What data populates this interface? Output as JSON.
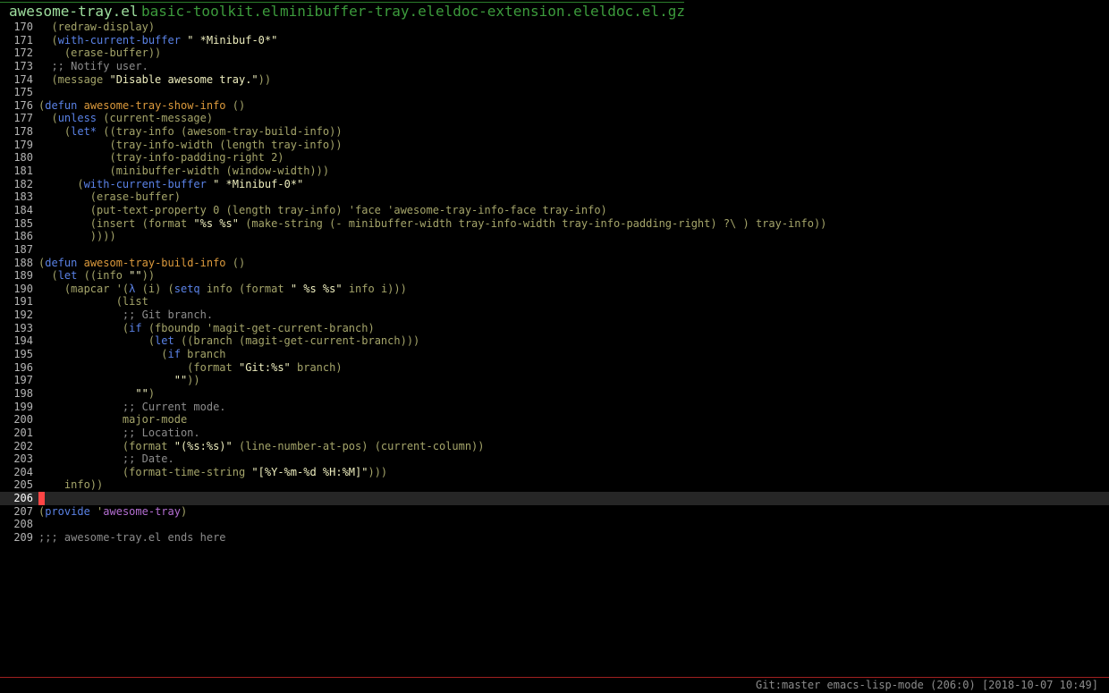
{
  "tabs": [
    {
      "label": "awesome-tray.el",
      "active": true
    },
    {
      "label": "basic-toolkit.el",
      "active": false
    },
    {
      "label": "minibuffer-tray.el",
      "active": false
    },
    {
      "label": "eldoc-extension.el",
      "active": false
    },
    {
      "label": "eldoc.el.gz",
      "active": false
    }
  ],
  "colors": {
    "background": "#000000",
    "tab_active": "#9fe09f",
    "tab_inactive": "#3c9b3c",
    "code_default": "#a5a56a",
    "keyword": "#5a82e6",
    "string": "#eeeebe",
    "comment": "#8c8c8c",
    "function_name": "#dc9a3c",
    "quoted_symbol": "#b46ed2",
    "cursor": "#ff4545",
    "current_line": "#262626"
  },
  "editor": {
    "current_line": 206,
    "lines": [
      {
        "n": 170,
        "tokens": [
          [
            "p",
            "  (redraw-display)"
          ]
        ]
      },
      {
        "n": 171,
        "tokens": [
          [
            "p",
            "  ("
          ],
          [
            "k",
            "with-current-buffer"
          ],
          [
            "p",
            " "
          ],
          [
            "s",
            "\" *Minibuf-0*\""
          ]
        ]
      },
      {
        "n": 172,
        "tokens": [
          [
            "p",
            "    (erase-buffer))"
          ]
        ]
      },
      {
        "n": 173,
        "tokens": [
          [
            "c",
            "  ;; Notify user."
          ]
        ]
      },
      {
        "n": 174,
        "tokens": [
          [
            "p",
            "  (message "
          ],
          [
            "s",
            "\"Disable awesome tray.\""
          ],
          [
            "p",
            "))"
          ]
        ]
      },
      {
        "n": 175,
        "tokens": []
      },
      {
        "n": 176,
        "tokens": [
          [
            "p",
            "("
          ],
          [
            "k",
            "defun"
          ],
          [
            "p",
            " "
          ],
          [
            "f",
            "awesome-tray-show-info"
          ],
          [
            "p",
            " ()"
          ]
        ]
      },
      {
        "n": 177,
        "tokens": [
          [
            "p",
            "  ("
          ],
          [
            "k",
            "unless"
          ],
          [
            "p",
            " (current-message)"
          ]
        ]
      },
      {
        "n": 178,
        "tokens": [
          [
            "p",
            "    ("
          ],
          [
            "k",
            "let*"
          ],
          [
            "p",
            " ((tray-info (awesom-tray-build-info))"
          ]
        ]
      },
      {
        "n": 179,
        "tokens": [
          [
            "p",
            "           (tray-info-width (length tray-info))"
          ]
        ]
      },
      {
        "n": 180,
        "tokens": [
          [
            "p",
            "           (tray-info-padding-right 2)"
          ]
        ]
      },
      {
        "n": 181,
        "tokens": [
          [
            "p",
            "           (minibuffer-width (window-width)))"
          ]
        ]
      },
      {
        "n": 182,
        "tokens": [
          [
            "p",
            "      ("
          ],
          [
            "k",
            "with-current-buffer"
          ],
          [
            "p",
            " "
          ],
          [
            "s",
            "\" *Minibuf-0*\""
          ]
        ]
      },
      {
        "n": 183,
        "tokens": [
          [
            "p",
            "        (erase-buffer)"
          ]
        ]
      },
      {
        "n": 184,
        "tokens": [
          [
            "p",
            "        (put-text-property 0 (length tray-info) 'face 'awesome-tray-info-face tray-info)"
          ]
        ]
      },
      {
        "n": 185,
        "tokens": [
          [
            "p",
            "        (insert (format "
          ],
          [
            "s",
            "\"%s %s\""
          ],
          [
            "p",
            " (make-string (- minibuffer-width tray-info-width tray-info-padding-right) ?\\ ) tray-info))"
          ]
        ]
      },
      {
        "n": 186,
        "tokens": [
          [
            "p",
            "        ))))"
          ]
        ]
      },
      {
        "n": 187,
        "tokens": []
      },
      {
        "n": 188,
        "tokens": [
          [
            "p",
            "("
          ],
          [
            "k",
            "defun"
          ],
          [
            "p",
            " "
          ],
          [
            "f",
            "awesom-tray-build-info"
          ],
          [
            "p",
            " ()"
          ]
        ]
      },
      {
        "n": 189,
        "tokens": [
          [
            "p",
            "  ("
          ],
          [
            "k",
            "let"
          ],
          [
            "p",
            " ((info "
          ],
          [
            "s",
            "\"\""
          ],
          [
            "p",
            "))"
          ]
        ]
      },
      {
        "n": 190,
        "tokens": [
          [
            "p",
            "    (mapcar '("
          ],
          [
            "k",
            "λ"
          ],
          [
            "p",
            " (i) ("
          ],
          [
            "k",
            "setq"
          ],
          [
            "p",
            " info (format "
          ],
          [
            "s",
            "\" %s %s\""
          ],
          [
            "p",
            " info i)))"
          ]
        ]
      },
      {
        "n": 191,
        "tokens": [
          [
            "p",
            "            (list"
          ]
        ]
      },
      {
        "n": 192,
        "tokens": [
          [
            "c",
            "             ;; Git branch."
          ]
        ]
      },
      {
        "n": 193,
        "tokens": [
          [
            "p",
            "             ("
          ],
          [
            "k",
            "if"
          ],
          [
            "p",
            " (fboundp 'magit-get-current-branch)"
          ]
        ]
      },
      {
        "n": 194,
        "tokens": [
          [
            "p",
            "                 ("
          ],
          [
            "k",
            "let"
          ],
          [
            "p",
            " ((branch (magit-get-current-branch)))"
          ]
        ]
      },
      {
        "n": 195,
        "tokens": [
          [
            "p",
            "                   ("
          ],
          [
            "k",
            "if"
          ],
          [
            "p",
            " branch"
          ]
        ]
      },
      {
        "n": 196,
        "tokens": [
          [
            "p",
            "                       (format "
          ],
          [
            "s",
            "\"Git:%s\""
          ],
          [
            "p",
            " branch)"
          ]
        ]
      },
      {
        "n": 197,
        "tokens": [
          [
            "p",
            "                     "
          ],
          [
            "s",
            "\"\""
          ],
          [
            "p",
            "))"
          ]
        ]
      },
      {
        "n": 198,
        "tokens": [
          [
            "p",
            "               "
          ],
          [
            "s",
            "\"\""
          ],
          [
            "p",
            ")"
          ]
        ]
      },
      {
        "n": 199,
        "tokens": [
          [
            "c",
            "             ;; Current mode."
          ]
        ]
      },
      {
        "n": 200,
        "tokens": [
          [
            "p",
            "             major-mode"
          ]
        ]
      },
      {
        "n": 201,
        "tokens": [
          [
            "c",
            "             ;; Location."
          ]
        ]
      },
      {
        "n": 202,
        "tokens": [
          [
            "p",
            "             (format "
          ],
          [
            "s",
            "\"(%s:%s)\""
          ],
          [
            "p",
            " (line-number-at-pos) (current-column))"
          ]
        ]
      },
      {
        "n": 203,
        "tokens": [
          [
            "c",
            "             ;; Date."
          ]
        ]
      },
      {
        "n": 204,
        "tokens": [
          [
            "p",
            "             (format-time-string "
          ],
          [
            "s",
            "\"[%Y-%m-%d %H:%M]\""
          ],
          [
            "p",
            ")))"
          ]
        ]
      },
      {
        "n": 205,
        "tokens": [
          [
            "p",
            "    info))"
          ]
        ]
      },
      {
        "n": 206,
        "tokens": []
      },
      {
        "n": 207,
        "tokens": [
          [
            "p",
            "("
          ],
          [
            "k",
            "provide"
          ],
          [
            "p",
            " '"
          ],
          [
            "q",
            "awesome-tray"
          ],
          [
            "p",
            ")"
          ]
        ]
      },
      {
        "n": 208,
        "tokens": []
      },
      {
        "n": 209,
        "tokens": [
          [
            "c",
            ";;; awesome-tray.el ends here"
          ]
        ]
      }
    ]
  },
  "status": {
    "git_branch": "Git:master",
    "major_mode": "emacs-lisp-mode",
    "position": "(206:0)",
    "datetime": "[2018-10-07 10:49]"
  }
}
